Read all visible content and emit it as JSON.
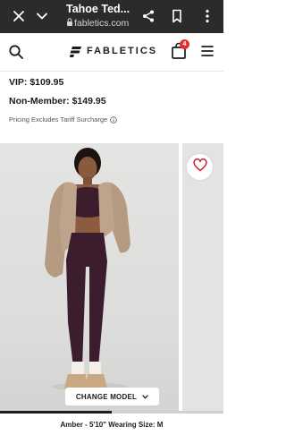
{
  "browser": {
    "title": "Tahoe Ted...",
    "url": "fabletics.com"
  },
  "header": {
    "brand": "FABLETICS",
    "cart_count": "4"
  },
  "product": {
    "vip_price": "VIP: $109.95",
    "non_member_price": "Non-Member: $149.95",
    "tariff_note": "Pricing Excludes Tariff Surcharge"
  },
  "gallery": {
    "change_model_label": "CHANGE MODEL",
    "progress": 0.5,
    "model_info": "Amber - 5'10\" Wearing Size: M"
  },
  "icons": [
    "close-icon",
    "chevron-down-icon",
    "share-icon",
    "bookmark-icon",
    "more-vertical-icon",
    "search-icon",
    "fabletics-logo-icon",
    "bag-icon",
    "menu-icon",
    "info-icon",
    "heart-icon"
  ],
  "colors": {
    "badge": "#e0312c",
    "legging": "#3b1d2d",
    "jacket": "#b59a82"
  }
}
